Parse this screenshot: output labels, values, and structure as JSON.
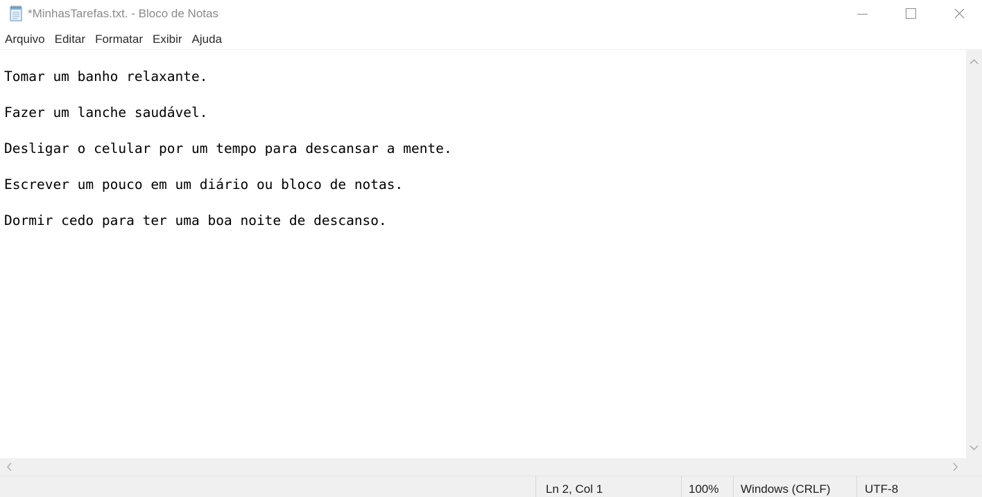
{
  "window": {
    "title": "*MinhasTarefas.txt. - Bloco de Notas",
    "icon": "notepad-icon",
    "controls": {
      "minimize_icon": "minimize-icon",
      "maximize_icon": "maximize-icon",
      "close_icon": "close-icon"
    }
  },
  "menu": {
    "items": [
      "Arquivo",
      "Editar",
      "Formatar",
      "Exibir",
      "Ajuda"
    ]
  },
  "editor": {
    "lines": [
      "Tomar um banho relaxante.",
      "Fazer um lanche saudável.",
      "Desligar o celular por um tempo para descansar a mente.",
      "Escrever um pouco em um diário ou bloco de notas.",
      "Dormir cedo para ter uma boa noite de descanso."
    ]
  },
  "statusbar": {
    "position": "Ln 2, Col 1",
    "zoom": "100%",
    "line_ending": "Windows (CRLF)",
    "encoding": "UTF-8"
  },
  "colors": {
    "chrome_background": "#f0f0f0",
    "title_text": "#8a8a8a",
    "text": "#000000"
  }
}
